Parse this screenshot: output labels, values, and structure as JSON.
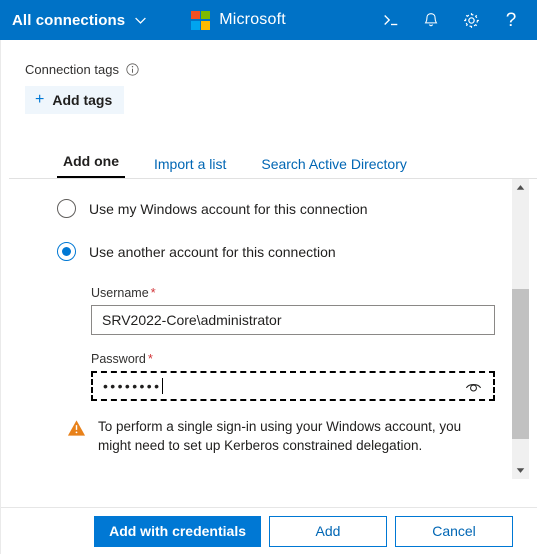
{
  "topbar": {
    "connections_label": "All connections",
    "chevron_icon": "chevron-down-icon",
    "brand": "Microsoft",
    "icons": [
      {
        "name": "terminal-icon",
        "title": ">_"
      },
      {
        "name": "bell-icon",
        "title": "Notifications"
      },
      {
        "name": "gear-icon",
        "title": "Settings"
      },
      {
        "name": "help-icon",
        "title": "?"
      }
    ],
    "help_glyph": "?",
    "colors": {
      "bar": "#0072C6",
      "logo_red": "#F25022",
      "logo_green": "#7FBA00",
      "logo_blue": "#00A4EF",
      "logo_yellow": "#FFB900"
    }
  },
  "tags": {
    "label": "Connection tags",
    "info_icon": "info-icon",
    "add_button_label": "Add tags",
    "add_button_icon": "plus-icon"
  },
  "tabs": [
    {
      "label": "Add one",
      "active": true
    },
    {
      "label": "Import a list",
      "active": false
    },
    {
      "label": "Search Active Directory",
      "active": false
    }
  ],
  "form": {
    "radios": [
      {
        "label": "Use my Windows account for this connection",
        "checked": false
      },
      {
        "label": "Use another account for this connection",
        "checked": true
      }
    ],
    "username": {
      "label": "Username",
      "required_mark": "*",
      "value": "SRV2022-Core\\administrator",
      "placeholder": ""
    },
    "password": {
      "label": "Password",
      "required_mark": "*",
      "value": "••••••••",
      "placeholder": "",
      "reveal_icon": "eye-icon",
      "focused": true
    },
    "warning": {
      "icon": "warning-triangle-icon",
      "text": "To perform a single sign-in using your Windows account, you might need to set up Kerberos constrained delegation.",
      "color": "#E8811A"
    }
  },
  "scrollbar": {
    "up_icon": "scroll-up-arrow-icon",
    "down_icon": "scroll-down-arrow-icon"
  },
  "footer": {
    "primary_label": "Add with credentials",
    "add_label": "Add",
    "cancel_label": "Cancel",
    "accent": "#0078D4"
  }
}
